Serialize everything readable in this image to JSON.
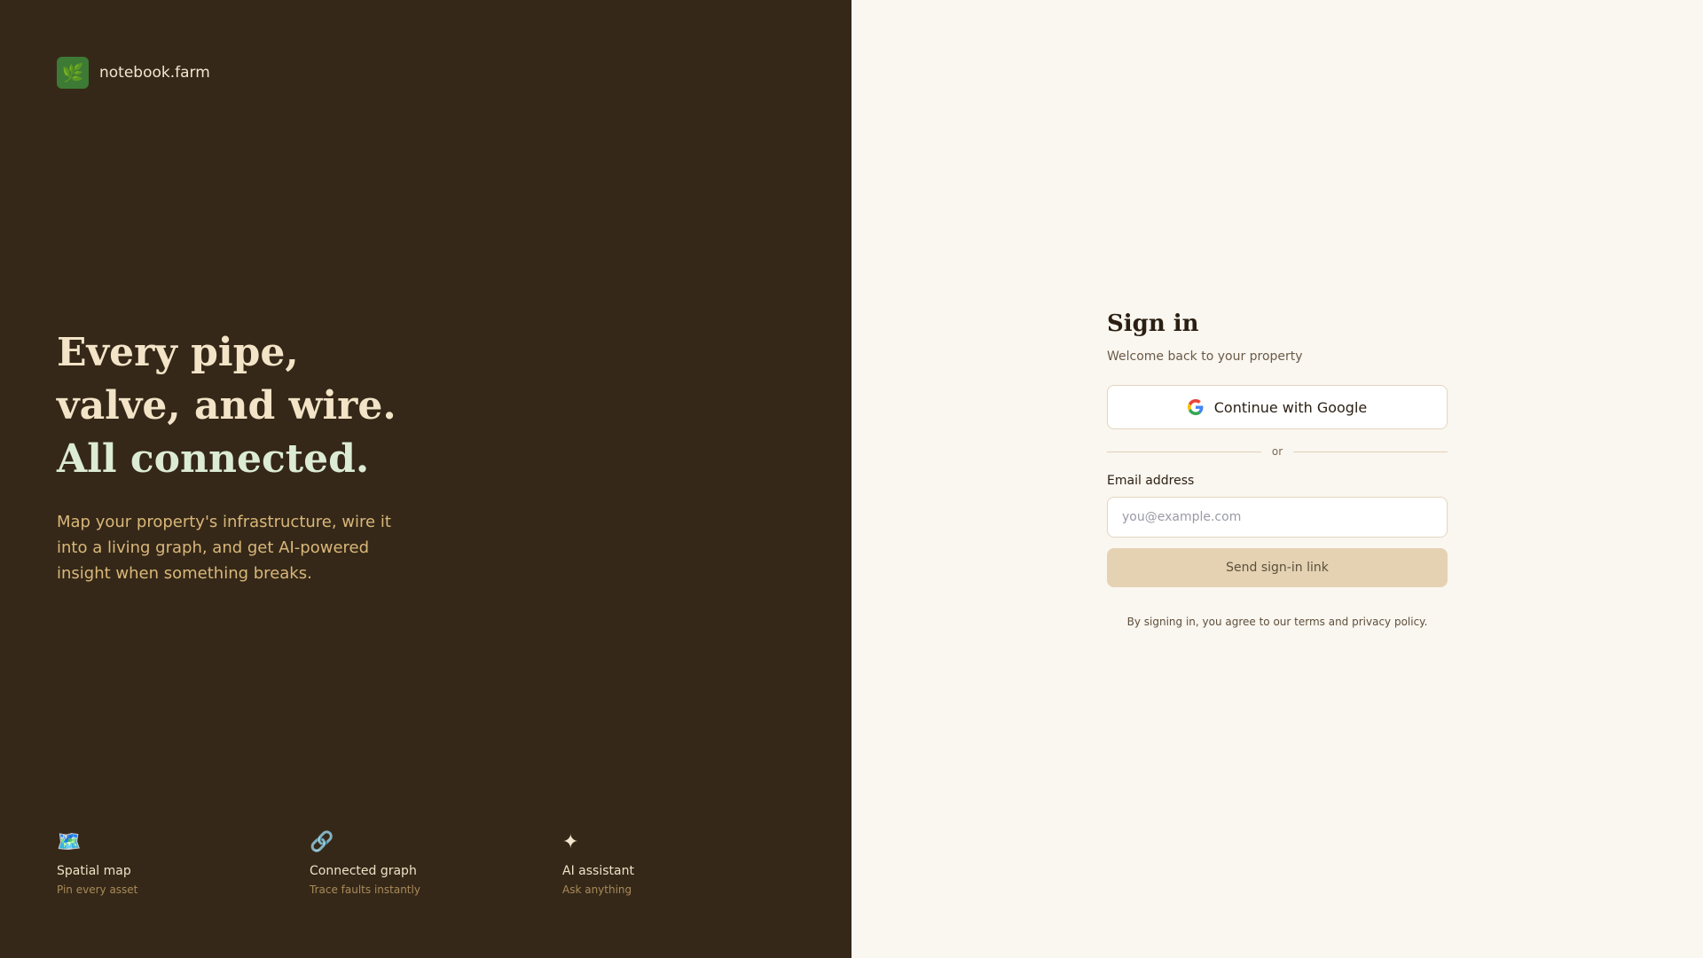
{
  "brand": {
    "logo_glyph": "🌿",
    "name": "notebook.farm"
  },
  "hero": {
    "headline_line1": "Every pipe,",
    "headline_line2": "valve, and wire.",
    "headline_line3": "All connected.",
    "description": "Map your property's infrastructure, wire it into a living graph, and get AI-powered insight when something breaks."
  },
  "features": [
    {
      "icon": "map-icon",
      "glyph": "🗺️",
      "title": "Spatial map",
      "subtitle": "Pin every asset"
    },
    {
      "icon": "link-icon",
      "glyph": "🔗",
      "title": "Connected graph",
      "subtitle": "Trace faults instantly"
    },
    {
      "icon": "sparkle-icon",
      "glyph": "✦",
      "title": "AI assistant",
      "subtitle": "Ask anything"
    }
  ],
  "signin": {
    "title": "Sign in",
    "subtitle": "Welcome back to your property",
    "google_label": "Continue with Google",
    "divider": "or",
    "email_label": "Email address",
    "email_value": "",
    "email_placeholder": "you@example.com",
    "send_label": "Send sign-in link",
    "terms": "By signing in, you agree to our terms and privacy policy."
  },
  "colors": {
    "left_bg": "#352818",
    "right_bg": "#faf6f0",
    "accent_green": "#3d7a35",
    "send_button_bg": "#e4d2b3"
  }
}
